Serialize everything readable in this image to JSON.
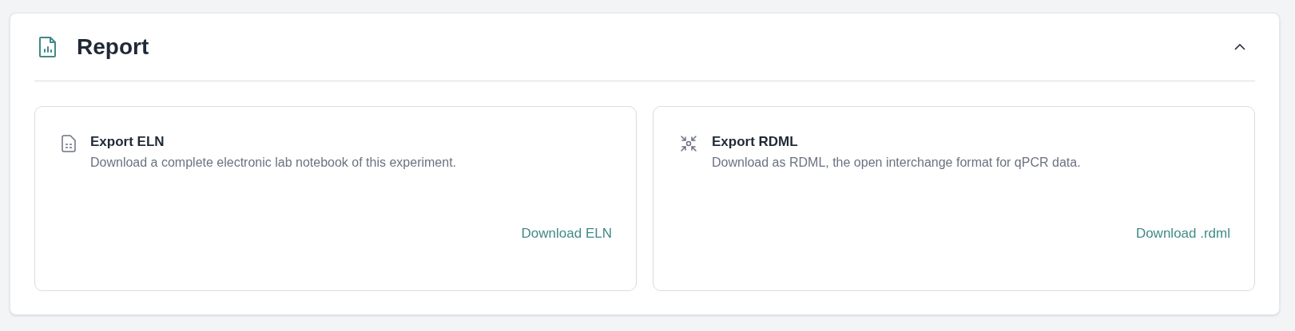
{
  "panel": {
    "title": "Report",
    "expanded": true
  },
  "cards": [
    {
      "kind": "document",
      "title": "Export ELN",
      "description": "Download a complete electronic lab notebook of this experiment.",
      "link": "Download ELN"
    },
    {
      "kind": "arrows",
      "title": "Export RDML",
      "description": "Download as RDML, the open interchange format for qPCR data.",
      "link": "Download .rdml"
    }
  ]
}
